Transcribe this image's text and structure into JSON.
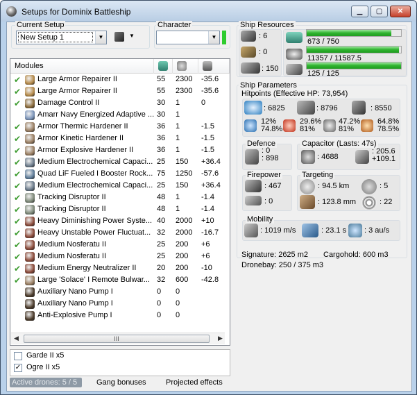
{
  "window": {
    "title": "Setups for Dominix Battleship",
    "minimize": "▁",
    "maximize": "▢",
    "close": "✕"
  },
  "setup": {
    "label": "Current Setup",
    "value": "New Setup 1"
  },
  "character": {
    "label": "Character",
    "value": ""
  },
  "modules": {
    "header": "Modules",
    "rows": [
      {
        "checked": true,
        "name": "Large Armor Repairer II",
        "c1": "55",
        "c2": "2300",
        "c3": "-35.6",
        "color": "#b58a4a"
      },
      {
        "checked": true,
        "name": "Large Armor Repairer II",
        "c1": "55",
        "c2": "2300",
        "c3": "-35.6",
        "color": "#b58a4a"
      },
      {
        "checked": true,
        "name": "Damage Control II",
        "c1": "30",
        "c2": "1",
        "c3": "0",
        "color": "#8a6a3a"
      },
      {
        "checked": false,
        "name": "Amarr Navy Energized Adaptive ...",
        "c1": "30",
        "c2": "1",
        "c3": "",
        "color": "#7a93b8"
      },
      {
        "checked": true,
        "name": "Armor Thermic Hardener II",
        "c1": "36",
        "c2": "1",
        "c3": "-1.5",
        "color": "#9a7f63"
      },
      {
        "checked": true,
        "name": "Armor Kinetic Hardener II",
        "c1": "36",
        "c2": "1",
        "c3": "-1.5",
        "color": "#9a7f63"
      },
      {
        "checked": true,
        "name": "Armor Explosive Hardener II",
        "c1": "36",
        "c2": "1",
        "c3": "-1.5",
        "color": "#9a7f63"
      },
      {
        "checked": true,
        "name": "Medium Electrochemical Capaci...",
        "c1": "25",
        "c2": "150",
        "c3": "+36.4",
        "color": "#6a7a8a"
      },
      {
        "checked": true,
        "name": "Quad LiF Fueled I Booster Rock...",
        "c1": "75",
        "c2": "1250",
        "c3": "-57.6",
        "color": "#5d7b98"
      },
      {
        "checked": true,
        "name": "Medium Electrochemical Capaci...",
        "c1": "25",
        "c2": "150",
        "c3": "+36.4",
        "color": "#6a7a8a"
      },
      {
        "checked": true,
        "name": "Tracking Disruptor II",
        "c1": "48",
        "c2": "1",
        "c3": "-1.4",
        "color": "#7f8a7a"
      },
      {
        "checked": true,
        "name": "Tracking Disruptor II",
        "c1": "48",
        "c2": "1",
        "c3": "-1.4",
        "color": "#7f8a7a"
      },
      {
        "checked": true,
        "name": "Heavy Diminishing Power Syste...",
        "c1": "40",
        "c2": "2000",
        "c3": "+10",
        "color": "#8a4a3a"
      },
      {
        "checked": true,
        "name": "Heavy Unstable Power Fluctuat...",
        "c1": "32",
        "c2": "2000",
        "c3": "-16.7",
        "color": "#8a4a3a"
      },
      {
        "checked": true,
        "name": "Medium Nosferatu II",
        "c1": "25",
        "c2": "200",
        "c3": "+6",
        "color": "#8a4a3a"
      },
      {
        "checked": true,
        "name": "Medium Nosferatu II",
        "c1": "25",
        "c2": "200",
        "c3": "+6",
        "color": "#8a4a3a"
      },
      {
        "checked": true,
        "name": "Medium Energy Neutralizer II",
        "c1": "20",
        "c2": "200",
        "c3": "-10",
        "color": "#8a4a3a"
      },
      {
        "checked": true,
        "name": "Large 'Solace' I Remote Bulwar...",
        "c1": "32",
        "c2": "600",
        "c3": "-42.8",
        "color": "#9a7f63"
      },
      {
        "checked": false,
        "name": "Auxiliary Nano Pump I",
        "c1": "0",
        "c2": "0",
        "c3": "",
        "color": "#4a3a2a"
      },
      {
        "checked": false,
        "name": "Auxiliary Nano Pump I",
        "c1": "0",
        "c2": "0",
        "c3": "",
        "color": "#4a3a2a"
      },
      {
        "checked": false,
        "name": "Anti-Explosive Pump I",
        "c1": "0",
        "c2": "0",
        "c3": "",
        "color": "#4a3a2a"
      }
    ]
  },
  "drones": [
    {
      "checked": false,
      "name": "Garde II x5"
    },
    {
      "checked": true,
      "name": "Ogre II x5"
    }
  ],
  "tabs": {
    "active": "Active drones: 5 / 5",
    "gang": "Gang bonuses",
    "projected": "Projected effects"
  },
  "resources": {
    "label": "Ship Resources",
    "hardpoints": [
      {
        "value": ": 6"
      },
      {
        "value": ": 0"
      },
      {
        "value": ": 150"
      }
    ],
    "bars": [
      {
        "text": "673 / 750",
        "fill": 0.897
      },
      {
        "text": "11357 / 11587.5",
        "fill": 0.98
      },
      {
        "text": "125 / 125",
        "fill": 1.0
      }
    ]
  },
  "params": {
    "label": "Ship Parameters",
    "hitpoints_label": "Hitpoints (Effective HP: 73,954)",
    "hp": [
      ": 6825",
      ": 8796",
      ": 8550"
    ],
    "resists": [
      {
        "a": "12%",
        "b": "74.8%"
      },
      {
        "a": "29.6%",
        "b": "81%"
      },
      {
        "a": "47.2%",
        "b": "81%"
      },
      {
        "a": "64.8%",
        "b": "78.5%"
      }
    ],
    "defence_label": "Defence",
    "defence": [
      ": 0",
      ": 898"
    ],
    "capacitor_label": "Capacitor (Lasts: 47s)",
    "capacitor_amount": ": 4688",
    "capacitor_rate": [
      ": 205.6",
      "+109.1"
    ],
    "firepower_label": "Firepower",
    "firepower": [
      ": 467",
      ": 0"
    ],
    "targeting_label": "Targeting",
    "targeting": {
      "range": ": 94.5 km",
      "targets": ": 5",
      "sigres": ": 123.8 mm",
      "scan": ": 22"
    },
    "mobility_label": "Mobility",
    "mobility": {
      "velocity": ": 1019 m/s",
      "align": ": 23.1 s",
      "warp": ": 3 au/s"
    }
  },
  "summary": {
    "signature": "Signature: 2625 m2",
    "cargo": "Cargohold: 600 m3",
    "dronebay": "Dronebay: 250 / 375 m3"
  }
}
